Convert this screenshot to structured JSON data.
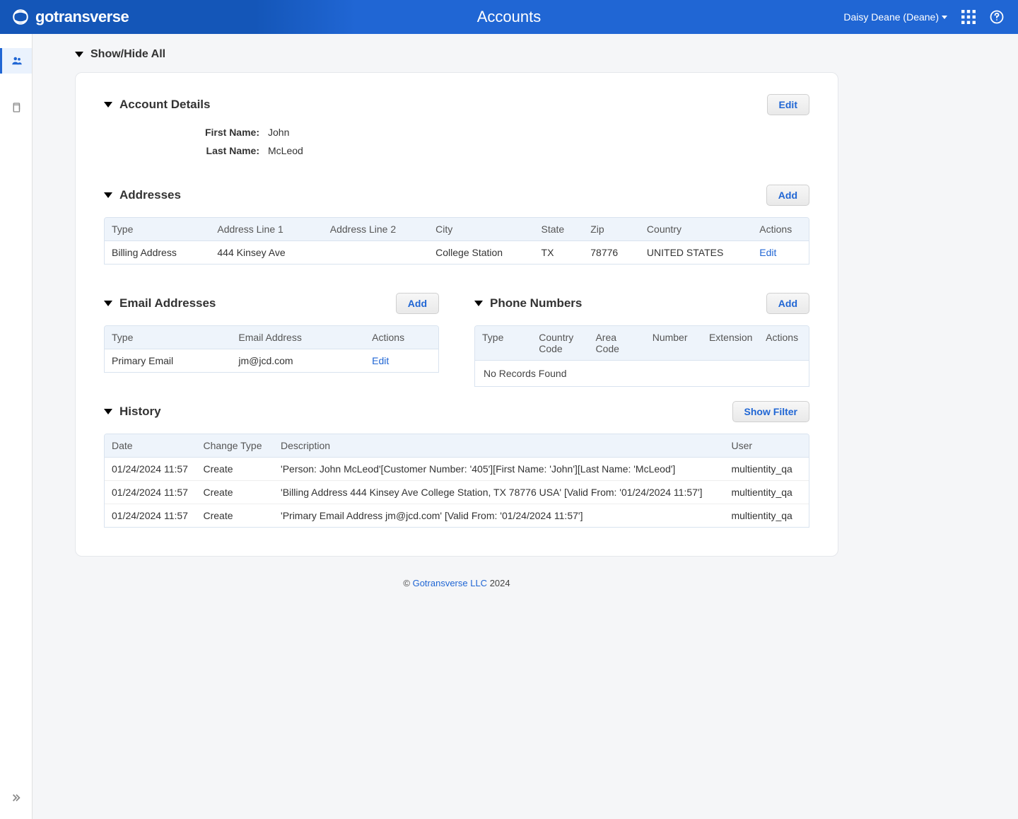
{
  "header": {
    "logo_text": "gotransverse",
    "page_title": "Accounts",
    "user_display": "Daisy Deane (Deane)"
  },
  "toggle_all": "Show/Hide All",
  "sections": {
    "account_details": {
      "title": "Account Details",
      "edit_label": "Edit",
      "first_name_label": "First Name:",
      "first_name_value": "John",
      "last_name_label": "Last Name:",
      "last_name_value": "McLeod"
    },
    "addresses": {
      "title": "Addresses",
      "add_label": "Add",
      "columns": {
        "type": "Type",
        "line1": "Address Line 1",
        "line2": "Address Line 2",
        "city": "City",
        "state": "State",
        "zip": "Zip",
        "country": "Country",
        "actions": "Actions"
      },
      "rows": [
        {
          "type": "Billing Address",
          "line1": "444 Kinsey Ave",
          "line2": "",
          "city": "College Station",
          "state": "TX",
          "zip": "78776",
          "country": "UNITED STATES",
          "action": "Edit"
        }
      ]
    },
    "emails": {
      "title": "Email Addresses",
      "add_label": "Add",
      "columns": {
        "type": "Type",
        "email": "Email Address",
        "actions": "Actions"
      },
      "rows": [
        {
          "type": "Primary Email",
          "email": "jm@jcd.com",
          "action": "Edit"
        }
      ]
    },
    "phones": {
      "title": "Phone Numbers",
      "add_label": "Add",
      "columns": {
        "type": "Type",
        "country_code": "Country Code",
        "area_code": "Area Code",
        "number": "Number",
        "extension": "Extension",
        "actions": "Actions"
      },
      "empty_text": "No Records Found"
    },
    "history": {
      "title": "History",
      "filter_label": "Show Filter",
      "columns": {
        "date": "Date",
        "change_type": "Change Type",
        "description": "Description",
        "user": "User"
      },
      "rows": [
        {
          "date": "01/24/2024 11:57",
          "change_type": "Create",
          "description": "'Person: John McLeod'[Customer Number: '405'][First Name: 'John'][Last Name: 'McLeod']",
          "user": "multientity_qa"
        },
        {
          "date": "01/24/2024 11:57",
          "change_type": "Create",
          "description": "'Billing Address 444 Kinsey Ave College Station, TX 78776 USA' [Valid From: '01/24/2024 11:57']",
          "user": "multientity_qa"
        },
        {
          "date": "01/24/2024 11:57",
          "change_type": "Create",
          "description": "'Primary Email Address jm@jcd.com' [Valid From: '01/24/2024 11:57']",
          "user": "multientity_qa"
        }
      ]
    }
  },
  "footer": {
    "copyright": "©",
    "link": "Gotransverse LLC",
    "year": "2024"
  }
}
